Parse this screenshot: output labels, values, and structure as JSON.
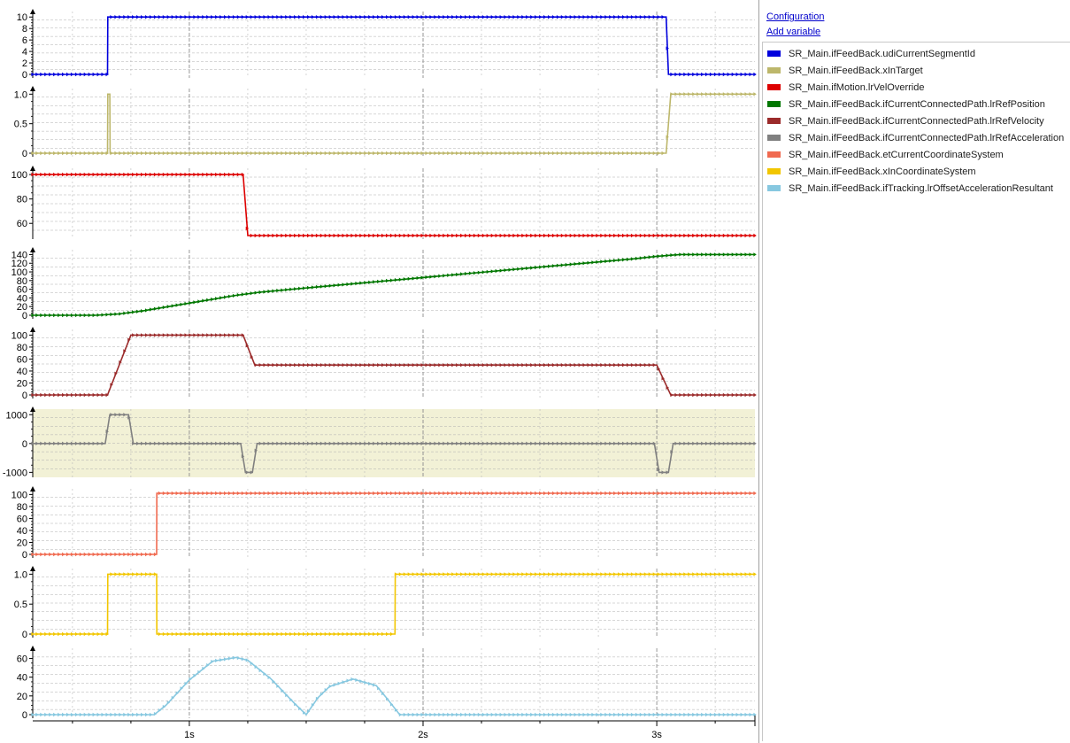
{
  "sidebar": {
    "configuration_link": "Configuration",
    "add_variable_link": "Add variable",
    "legend": [
      {
        "name": "SR_Main.ifFeedBack.udiCurrentSegmentId",
        "color": "#0000dd"
      },
      {
        "name": "SR_Main.ifFeedBack.xInTarget",
        "color": "#bdb76b"
      },
      {
        "name": "SR_Main.ifMotion.lrVelOverride",
        "color": "#dd0000"
      },
      {
        "name": "SR_Main.ifFeedBack.ifCurrentConnectedPath.lrRefPosition",
        "color": "#007700"
      },
      {
        "name": "SR_Main.ifFeedBack.ifCurrentConnectedPath.lrRefVelocity",
        "color": "#9b2b2b"
      },
      {
        "name": "SR_Main.ifFeedBack.ifCurrentConnectedPath.lrRefAcceleration",
        "color": "#808080"
      },
      {
        "name": "SR_Main.ifFeedBack.etCurrentCoordinateSystem",
        "color": "#f06a50"
      },
      {
        "name": "SR_Main.ifFeedBack.xInCoordinateSystem",
        "color": "#f2c600"
      },
      {
        "name": "SR_Main.ifFeedBack.ifTracking.lrOffsetAccelerationResultant",
        "color": "#87c8e0"
      }
    ]
  },
  "chart_data": {
    "type": "line",
    "xlim": [
      0.33,
      3.42
    ],
    "x_ticks": [
      {
        "value": 1,
        "label": "1s"
      },
      {
        "value": 2,
        "label": "2s"
      },
      {
        "value": 3,
        "label": "3s"
      }
    ],
    "panels": [
      {
        "series": "SR_Main.ifFeedBack.udiCurrentSegmentId",
        "color": "#0000dd",
        "ylim": [
          0,
          10.5
        ],
        "yticks": [
          0,
          2,
          4,
          6,
          8,
          10
        ],
        "tick_labels": [
          "0",
          "2",
          "4",
          "6",
          "8",
          "10"
        ],
        "x": [
          0.33,
          0.65,
          0.651,
          3.04,
          3.05,
          3.42
        ],
        "y": [
          0,
          0,
          10,
          10,
          0,
          0
        ]
      },
      {
        "series": "SR_Main.ifFeedBack.xInTarget",
        "color": "#bdb76b",
        "ylim": [
          0,
          1.05
        ],
        "yticks": [
          0,
          0.5,
          1.0
        ],
        "tick_labels": [
          "0",
          "0.5",
          "1.0"
        ],
        "x": [
          0.33,
          0.65,
          0.651,
          0.66,
          0.661,
          3.04,
          3.06,
          3.42
        ],
        "y": [
          0,
          0,
          1,
          1,
          0,
          0,
          1,
          1
        ]
      },
      {
        "series": "SR_Main.ifMotion.lrVelOverride",
        "color": "#dd0000",
        "ylim": [
          50,
          103
        ],
        "yticks": [
          60,
          80,
          100
        ],
        "tick_labels": [
          "60",
          "80",
          "100"
        ],
        "x": [
          0.33,
          1.23,
          1.25,
          3.42
        ],
        "y": [
          100,
          100,
          50,
          50
        ]
      },
      {
        "series": "SR_Main.ifFeedBack.ifCurrentConnectedPath.lrRefPosition",
        "color": "#007700",
        "ylim": [
          0,
          145
        ],
        "yticks": [
          0,
          20,
          40,
          60,
          80,
          100,
          120,
          140
        ],
        "tick_labels": [
          "0",
          "20",
          "40",
          "60",
          "80",
          "100",
          "120",
          "140"
        ],
        "x": [
          0.33,
          0.6,
          0.7,
          0.8,
          0.9,
          1.0,
          1.1,
          1.2,
          1.3,
          1.5,
          1.75,
          2.0,
          2.25,
          2.5,
          2.75,
          2.9,
          3.0,
          3.1,
          3.42
        ],
        "y": [
          0,
          0,
          3,
          10,
          19,
          28,
          37,
          46,
          53,
          63,
          75,
          87,
          99,
          111,
          123,
          130,
          136,
          140,
          140
        ]
      },
      {
        "series": "SR_Main.ifFeedBack.ifCurrentConnectedPath.lrRefVelocity",
        "color": "#9b2b2b",
        "ylim": [
          0,
          105
        ],
        "yticks": [
          0,
          20,
          40,
          60,
          80,
          100
        ],
        "tick_labels": [
          "0",
          "20",
          "40",
          "60",
          "80",
          "100"
        ],
        "x": [
          0.33,
          0.65,
          0.75,
          1.23,
          1.28,
          3.0,
          3.06,
          3.42
        ],
        "y": [
          0,
          0,
          100,
          100,
          50,
          50,
          0,
          0
        ]
      },
      {
        "series": "SR_Main.ifFeedBack.ifCurrentConnectedPath.lrRefAcceleration",
        "color": "#808080",
        "ylim": [
          -1050,
          1100
        ],
        "yticks": [
          -1000,
          0,
          1000
        ],
        "tick_labels": [
          "-1000",
          "0",
          "1000"
        ],
        "x": [
          0.33,
          0.64,
          0.66,
          0.74,
          0.76,
          1.22,
          1.24,
          1.27,
          1.29,
          2.99,
          3.01,
          3.05,
          3.07,
          3.42
        ],
        "y": [
          0,
          0,
          1000,
          1000,
          0,
          0,
          -1000,
          -1000,
          0,
          0,
          -1000,
          -1000,
          0,
          0
        ],
        "band": [
          -1000,
          1000
        ]
      },
      {
        "series": "SR_Main.ifFeedBack.etCurrentCoordinateSystem",
        "color": "#f06a50",
        "ylim": [
          0,
          105
        ],
        "yticks": [
          0,
          20,
          40,
          60,
          80,
          100
        ],
        "tick_labels": [
          "0",
          "20",
          "40",
          "60",
          "80",
          "100"
        ],
        "x": [
          0.33,
          0.86,
          0.861,
          3.42
        ],
        "y": [
          0,
          0,
          102,
          102
        ]
      },
      {
        "series": "SR_Main.ifFeedBack.xInCoordinateSystem",
        "color": "#f2c600",
        "ylim": [
          0,
          1.05
        ],
        "yticks": [
          0,
          0.5,
          1.0
        ],
        "tick_labels": [
          "0",
          "0.5",
          "1.0"
        ],
        "x": [
          0.33,
          0.65,
          0.651,
          0.86,
          0.861,
          1.88,
          1.881,
          3.42
        ],
        "y": [
          0,
          0,
          1,
          1,
          0,
          0,
          1,
          1
        ]
      },
      {
        "series": "SR_Main.ifFeedBack.ifTracking.lrOffsetAccelerationResultant",
        "color": "#87c8e0",
        "ylim": [
          0,
          68
        ],
        "yticks": [
          0,
          20,
          40,
          60
        ],
        "tick_labels": [
          "0",
          "20",
          "40",
          "60"
        ],
        "x": [
          0.33,
          0.85,
          0.9,
          1.0,
          1.1,
          1.2,
          1.25,
          1.35,
          1.45,
          1.5,
          1.55,
          1.6,
          1.7,
          1.8,
          1.85,
          1.9,
          3.42
        ],
        "y": [
          0,
          0,
          10,
          37,
          57,
          61,
          58,
          38,
          12,
          0,
          18,
          30,
          38,
          31,
          16,
          0,
          0
        ]
      }
    ]
  }
}
